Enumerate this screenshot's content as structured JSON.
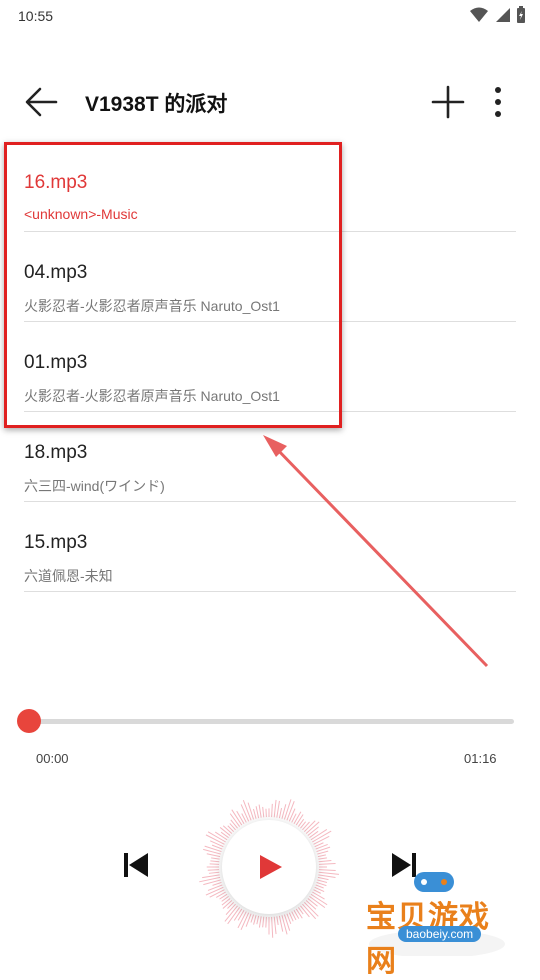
{
  "status": {
    "time": "10:55"
  },
  "header": {
    "title": "V1938T 的派对"
  },
  "songs": [
    {
      "title": "16.mp3",
      "artist": "<unknown>-Music"
    },
    {
      "title": "04.mp3",
      "artist": "火影忍者-火影忍者原声音乐 Naruto_Ost1"
    },
    {
      "title": "01.mp3",
      "artist": "火影忍者-火影忍者原声音乐 Naruto_Ost1"
    },
    {
      "title": "18.mp3",
      "artist": "六三四-wind(ワインド)"
    },
    {
      "title": "15.mp3",
      "artist": "六道佩恩-未知"
    }
  ],
  "player": {
    "current_time": "00:00",
    "total_time": "01:16",
    "progress": 0
  },
  "watermark": {
    "name": "宝贝游戏网",
    "url": "baobeiy.com"
  },
  "colors": {
    "accent": "#e03838",
    "annotation": "#e02020"
  }
}
